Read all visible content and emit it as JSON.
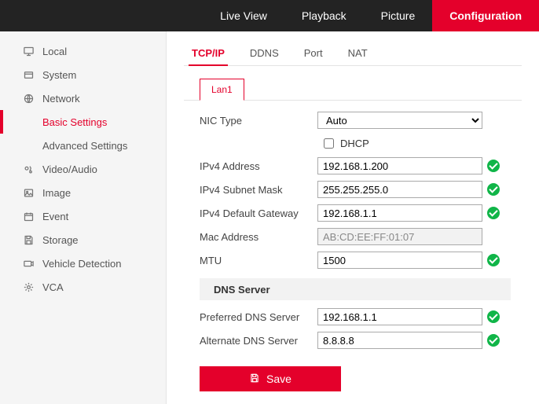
{
  "topnav": {
    "items": [
      "Live View",
      "Playback",
      "Picture",
      "Configuration"
    ],
    "active": 3
  },
  "sidebar": {
    "items": [
      {
        "label": "Local"
      },
      {
        "label": "System"
      },
      {
        "label": "Network",
        "sub": [
          {
            "label": "Basic Settings",
            "active": true
          },
          {
            "label": "Advanced Settings"
          }
        ]
      },
      {
        "label": "Video/Audio"
      },
      {
        "label": "Image"
      },
      {
        "label": "Event"
      },
      {
        "label": "Storage"
      },
      {
        "label": "Vehicle Detection"
      },
      {
        "label": "VCA"
      }
    ]
  },
  "tabs": {
    "items": [
      "TCP/IP",
      "DDNS",
      "Port",
      "NAT"
    ],
    "active": 0
  },
  "lan": {
    "items": [
      "Lan1"
    ],
    "active": 0
  },
  "fields": {
    "nic_type": {
      "label": "NIC Type",
      "value": "Auto"
    },
    "dhcp": {
      "label": "DHCP",
      "checked": false
    },
    "ipv4_addr": {
      "label": "IPv4 Address",
      "value": "192.168.1.200"
    },
    "ipv4_mask": {
      "label": "IPv4 Subnet Mask",
      "value": "255.255.255.0"
    },
    "ipv4_gw": {
      "label": "IPv4 Default Gateway",
      "value": "192.168.1.1"
    },
    "mac": {
      "label": "Mac Address",
      "value": "AB:CD:EE:FF:01:07"
    },
    "mtu": {
      "label": "MTU",
      "value": "1500"
    },
    "dns_header": "DNS Server",
    "dns_pref": {
      "label": "Preferred DNS Server",
      "value": "192.168.1.1"
    },
    "dns_alt": {
      "label": "Alternate DNS Server",
      "value": "8.8.8.8"
    }
  },
  "save_label": "Save",
  "colors": {
    "accent": "#e4002b",
    "ok": "#10b548"
  }
}
